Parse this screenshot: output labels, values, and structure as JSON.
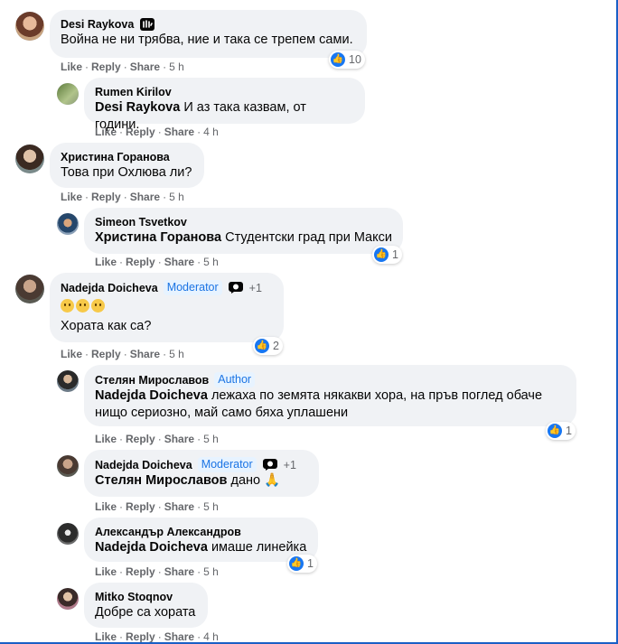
{
  "labels": {
    "like": "Like",
    "reply": "Reply",
    "share": "Share",
    "sep": "·"
  },
  "colors": {
    "badge_text": "#1b74e4",
    "bubble": "#f0f2f5",
    "like_blue": "#1877f2",
    "meta_gray": "#65676b"
  },
  "comments": [
    {
      "author": "Desi Raykova",
      "text": "Война не ни трябва, ние и така се трепем сами.",
      "time": "5 h",
      "reactions": "10",
      "icon": "wave-icon"
    },
    {
      "author": "Rumen Kirilov",
      "mention": "Desi Raykova",
      "text": " И аз така казвам, от години.",
      "time": "4 h"
    },
    {
      "author": "Христина Горанова",
      "text": "Това при Охлюва ли?",
      "time": "5 h"
    },
    {
      "author": "Simeon Tsvetkov",
      "mention": "Христина Горанова",
      "text": " Студентски град при Макси",
      "time": "5 h",
      "reactions": "1"
    },
    {
      "author": "Nadejda Doicheva",
      "badge": "Moderator",
      "plus": "+1",
      "text": "Хората как са?",
      "time": "5 h",
      "reactions": "2",
      "icon": "fan-icon"
    },
    {
      "author": "Стелян Мирославов",
      "badge": "Author",
      "mention": "Nadejda Doicheva",
      "text": " лежаха по земята някакви хора, на пръв поглед обаче нищо сериозно, май само бяха уплашени",
      "time": "5 h",
      "reactions": "1"
    },
    {
      "author": "Nadejda Doicheva",
      "badge": "Moderator",
      "plus": "+1",
      "mention": "Стелян Мирославов",
      "text": " дано 🙏",
      "time": "5 h",
      "icon": "fan-icon"
    },
    {
      "author": "Александър Александров",
      "mention": "Nadejda Doicheva",
      "text": " имаше линейка",
      "time": "5 h",
      "reactions": "1"
    },
    {
      "author": "Mitko Stoqnov",
      "text": "Добре са хората",
      "time": "4 h"
    }
  ]
}
